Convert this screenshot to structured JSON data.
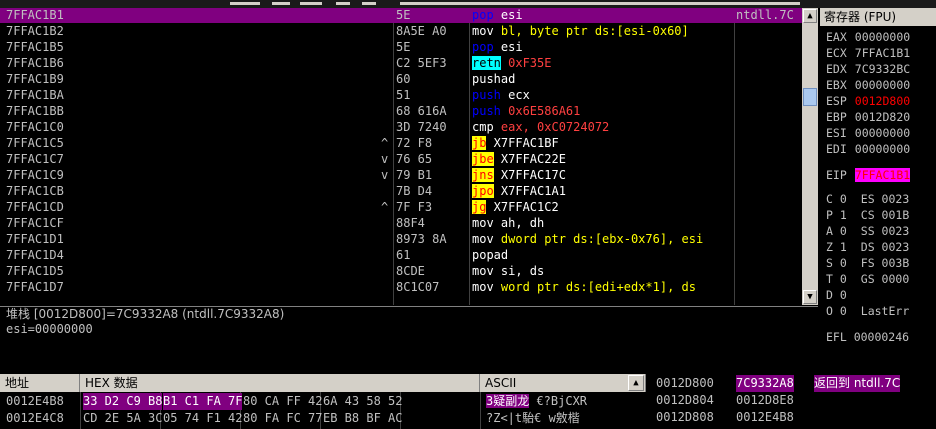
{
  "disasm": {
    "rows": [
      {
        "addr": "7FFAC1B1",
        "jmp": "",
        "hex": "5E",
        "mn": "pop",
        "mn_style": "blue",
        "ops": " esi",
        "ops_style": "white",
        "comment": "ntdll.7C",
        "sel": true
      },
      {
        "addr": "7FFAC1B2",
        "jmp": "",
        "hex": "8A5E A0",
        "mn": "mov",
        "mn_style": "white",
        "ops": " bl, byte ptr ds:[esi-0x60]",
        "ops_style": "yellow",
        "comment": "",
        "sel": false
      },
      {
        "addr": "7FFAC1B5",
        "jmp": "",
        "hex": "5E",
        "mn": "pop",
        "mn_style": "blue",
        "ops": " esi",
        "ops_style": "white",
        "comment": "",
        "sel": false
      },
      {
        "addr": "7FFAC1B6",
        "jmp": "",
        "hex": "C2 5EF3",
        "mn": "retn",
        "mn_style": "cyan",
        "ops": " 0xF35E",
        "ops_style": "red",
        "comment": "",
        "sel": false
      },
      {
        "addr": "7FFAC1B9",
        "jmp": "",
        "hex": "60",
        "mn": "pushad",
        "mn_style": "white",
        "ops": "",
        "ops_style": "white",
        "comment": "",
        "sel": false
      },
      {
        "addr": "7FFAC1BA",
        "jmp": "",
        "hex": "51",
        "mn": "push",
        "mn_style": "blue",
        "ops": " ecx",
        "ops_style": "white",
        "comment": "",
        "sel": false
      },
      {
        "addr": "7FFAC1BB",
        "jmp": "",
        "hex": "68 616A",
        "mn": "push",
        "mn_style": "blue",
        "ops": " 0x6E586A61",
        "ops_style": "red",
        "comment": "",
        "sel": false
      },
      {
        "addr": "7FFAC1C0",
        "jmp": "",
        "hex": "3D 7240",
        "mn": "cmp",
        "mn_style": "white",
        "ops": " eax, 0xC0724072",
        "ops_style": "red",
        "comment": "",
        "sel": false
      },
      {
        "addr": "7FFAC1C5",
        "jmp": "^",
        "hex": "72 F8",
        "mn": "jb",
        "mn_style": "yellow",
        "ops": " X7FFAC1BF",
        "ops_style": "white",
        "comment": "",
        "sel": false
      },
      {
        "addr": "7FFAC1C7",
        "jmp": "v",
        "hex": "76 65",
        "mn": "jbe",
        "mn_style": "yellow",
        "ops": " X7FFAC22E",
        "ops_style": "white",
        "comment": "",
        "sel": false
      },
      {
        "addr": "7FFAC1C9",
        "jmp": "v",
        "hex": "79 B1",
        "mn": "jns",
        "mn_style": "yellow",
        "ops": " X7FFAC17C",
        "ops_style": "white",
        "comment": "",
        "sel": false
      },
      {
        "addr": "7FFAC1CB",
        "jmp": "",
        "hex": "7B D4",
        "mn": "jpo",
        "mn_style": "yellow",
        "ops": " X7FFAC1A1",
        "ops_style": "white",
        "comment": "",
        "sel": false
      },
      {
        "addr": "7FFAC1CD",
        "jmp": "^",
        "hex": "7F F3",
        "mn": "jg",
        "mn_style": "yellow",
        "ops": " X7FFAC1C2",
        "ops_style": "white",
        "comment": "",
        "sel": false
      },
      {
        "addr": "7FFAC1CF",
        "jmp": "",
        "hex": "88F4",
        "mn": "mov",
        "mn_style": "white",
        "ops": " ah, dh",
        "ops_style": "white",
        "comment": "",
        "sel": false
      },
      {
        "addr": "7FFAC1D1",
        "jmp": "",
        "hex": "8973 8A",
        "mn": "mov",
        "mn_style": "white",
        "ops": " dword ptr ds:[ebx-0x76], esi",
        "ops_style": "yellow",
        "comment": "",
        "sel": false
      },
      {
        "addr": "7FFAC1D4",
        "jmp": "",
        "hex": "61",
        "mn": "popad",
        "mn_style": "white",
        "ops": "",
        "ops_style": "white",
        "comment": "",
        "sel": false
      },
      {
        "addr": "7FFAC1D5",
        "jmp": "",
        "hex": "8CDE",
        "mn": "mov",
        "mn_style": "white",
        "ops": " si, ds",
        "ops_style": "white",
        "comment": "",
        "sel": false
      },
      {
        "addr": "7FFAC1D7",
        "jmp": "",
        "hex": "8C1C07",
        "mn": "mov",
        "mn_style": "white",
        "ops": " word ptr ds:[edi+edx*1], ds",
        "ops_style": "yellow",
        "comment": "",
        "sel": false
      }
    ]
  },
  "registers": {
    "title": "寄存器 (FPU)",
    "regs": [
      {
        "name": "EAX",
        "val": "00000000",
        "style": ""
      },
      {
        "name": "ECX",
        "val": "7FFAC1B1",
        "style": ""
      },
      {
        "name": "EDX",
        "val": "7C9332BC",
        "style": ""
      },
      {
        "name": "EBX",
        "val": "00000000",
        "style": ""
      },
      {
        "name": "ESP",
        "val": "0012D800",
        "style": "red"
      },
      {
        "name": "EBP",
        "val": "0012D820",
        "style": ""
      },
      {
        "name": "ESI",
        "val": "00000000",
        "style": ""
      },
      {
        "name": "EDI",
        "val": "00000000",
        "style": ""
      }
    ],
    "eip": {
      "name": "EIP",
      "val": "7FFAC1B1"
    },
    "flags": [
      {
        "f": "C 0",
        "seg": "ES 0023"
      },
      {
        "f": "P 1",
        "seg": "CS 001B"
      },
      {
        "f": "A 0",
        "seg": "SS 0023"
      },
      {
        "f": "Z 1",
        "seg": "DS 0023"
      },
      {
        "f": "S 0",
        "seg": "FS 003B"
      },
      {
        "f": "T 0",
        "seg": "GS 0000"
      },
      {
        "f": "D 0",
        "seg": ""
      },
      {
        "f": "O 0",
        "seg": "LastErr"
      }
    ],
    "efl": "EFL 00000246"
  },
  "info": {
    "line1": "堆栈 [0012D800]=7C9332A8 (ntdll.7C9332A8)",
    "line2": "esi=00000000"
  },
  "dump": {
    "headers": {
      "addr": "地址",
      "hex": "HEX 数据",
      "ascii": "ASCII"
    },
    "rows": [
      {
        "addr": "0012E4B8",
        "groups": [
          "33 D2 C9 B8",
          "B1 C1 FA 7F",
          "80 CA FF 42",
          "6A 43 58 52"
        ],
        "hl": [
          true,
          true,
          false,
          false
        ],
        "ascii": "3疑副龙 €?BjCXR",
        "ascii_hl_prefix": "3疑副龙"
      },
      {
        "addr": "0012E4C8",
        "groups": [
          "CD 2E 5A 3C",
          "05 74 F1 42",
          "80 FA FC 77",
          "EB B8 BF AC"
        ],
        "hl": [
          false,
          false,
          false,
          false
        ],
        "ascii": "?Z<|t駘€ w敫楷",
        "ascii_hl_prefix": ""
      }
    ]
  },
  "stack": {
    "rows": [
      {
        "addr": "0012D800",
        "val": "7C9332A8",
        "cmt": "返回到 ntdll.7C",
        "sel": true
      },
      {
        "addr": "0012D804",
        "val": "0012D8E8",
        "cmt": "",
        "sel": false
      },
      {
        "addr": "0012D808",
        "val": "0012E4B8",
        "cmt": "",
        "sel": false
      }
    ]
  }
}
